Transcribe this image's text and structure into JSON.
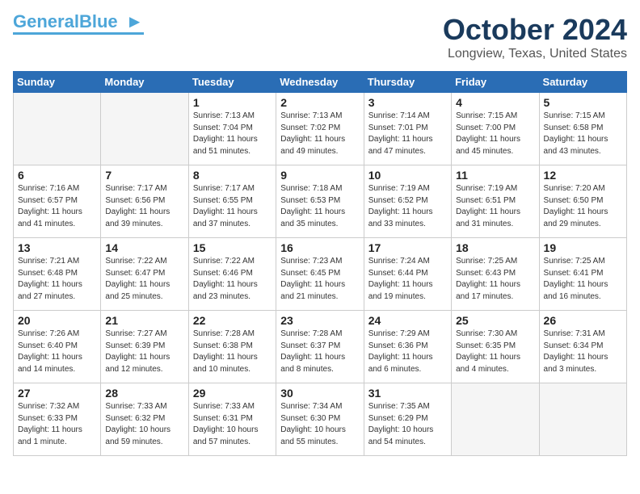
{
  "header": {
    "logo_general": "General",
    "logo_blue": "Blue",
    "month_title": "October 2024",
    "location": "Longview, Texas, United States"
  },
  "weekdays": [
    "Sunday",
    "Monday",
    "Tuesday",
    "Wednesday",
    "Thursday",
    "Friday",
    "Saturday"
  ],
  "weeks": [
    [
      {
        "day": "",
        "empty": true
      },
      {
        "day": "",
        "empty": true
      },
      {
        "day": "1",
        "sunrise": "Sunrise: 7:13 AM",
        "sunset": "Sunset: 7:04 PM",
        "daylight": "Daylight: 11 hours and 51 minutes."
      },
      {
        "day": "2",
        "sunrise": "Sunrise: 7:13 AM",
        "sunset": "Sunset: 7:02 PM",
        "daylight": "Daylight: 11 hours and 49 minutes."
      },
      {
        "day": "3",
        "sunrise": "Sunrise: 7:14 AM",
        "sunset": "Sunset: 7:01 PM",
        "daylight": "Daylight: 11 hours and 47 minutes."
      },
      {
        "day": "4",
        "sunrise": "Sunrise: 7:15 AM",
        "sunset": "Sunset: 7:00 PM",
        "daylight": "Daylight: 11 hours and 45 minutes."
      },
      {
        "day": "5",
        "sunrise": "Sunrise: 7:15 AM",
        "sunset": "Sunset: 6:58 PM",
        "daylight": "Daylight: 11 hours and 43 minutes."
      }
    ],
    [
      {
        "day": "6",
        "sunrise": "Sunrise: 7:16 AM",
        "sunset": "Sunset: 6:57 PM",
        "daylight": "Daylight: 11 hours and 41 minutes."
      },
      {
        "day": "7",
        "sunrise": "Sunrise: 7:17 AM",
        "sunset": "Sunset: 6:56 PM",
        "daylight": "Daylight: 11 hours and 39 minutes."
      },
      {
        "day": "8",
        "sunrise": "Sunrise: 7:17 AM",
        "sunset": "Sunset: 6:55 PM",
        "daylight": "Daylight: 11 hours and 37 minutes."
      },
      {
        "day": "9",
        "sunrise": "Sunrise: 7:18 AM",
        "sunset": "Sunset: 6:53 PM",
        "daylight": "Daylight: 11 hours and 35 minutes."
      },
      {
        "day": "10",
        "sunrise": "Sunrise: 7:19 AM",
        "sunset": "Sunset: 6:52 PM",
        "daylight": "Daylight: 11 hours and 33 minutes."
      },
      {
        "day": "11",
        "sunrise": "Sunrise: 7:19 AM",
        "sunset": "Sunset: 6:51 PM",
        "daylight": "Daylight: 11 hours and 31 minutes."
      },
      {
        "day": "12",
        "sunrise": "Sunrise: 7:20 AM",
        "sunset": "Sunset: 6:50 PM",
        "daylight": "Daylight: 11 hours and 29 minutes."
      }
    ],
    [
      {
        "day": "13",
        "sunrise": "Sunrise: 7:21 AM",
        "sunset": "Sunset: 6:48 PM",
        "daylight": "Daylight: 11 hours and 27 minutes."
      },
      {
        "day": "14",
        "sunrise": "Sunrise: 7:22 AM",
        "sunset": "Sunset: 6:47 PM",
        "daylight": "Daylight: 11 hours and 25 minutes."
      },
      {
        "day": "15",
        "sunrise": "Sunrise: 7:22 AM",
        "sunset": "Sunset: 6:46 PM",
        "daylight": "Daylight: 11 hours and 23 minutes."
      },
      {
        "day": "16",
        "sunrise": "Sunrise: 7:23 AM",
        "sunset": "Sunset: 6:45 PM",
        "daylight": "Daylight: 11 hours and 21 minutes."
      },
      {
        "day": "17",
        "sunrise": "Sunrise: 7:24 AM",
        "sunset": "Sunset: 6:44 PM",
        "daylight": "Daylight: 11 hours and 19 minutes."
      },
      {
        "day": "18",
        "sunrise": "Sunrise: 7:25 AM",
        "sunset": "Sunset: 6:43 PM",
        "daylight": "Daylight: 11 hours and 17 minutes."
      },
      {
        "day": "19",
        "sunrise": "Sunrise: 7:25 AM",
        "sunset": "Sunset: 6:41 PM",
        "daylight": "Daylight: 11 hours and 16 minutes."
      }
    ],
    [
      {
        "day": "20",
        "sunrise": "Sunrise: 7:26 AM",
        "sunset": "Sunset: 6:40 PM",
        "daylight": "Daylight: 11 hours and 14 minutes."
      },
      {
        "day": "21",
        "sunrise": "Sunrise: 7:27 AM",
        "sunset": "Sunset: 6:39 PM",
        "daylight": "Daylight: 11 hours and 12 minutes."
      },
      {
        "day": "22",
        "sunrise": "Sunrise: 7:28 AM",
        "sunset": "Sunset: 6:38 PM",
        "daylight": "Daylight: 11 hours and 10 minutes."
      },
      {
        "day": "23",
        "sunrise": "Sunrise: 7:28 AM",
        "sunset": "Sunset: 6:37 PM",
        "daylight": "Daylight: 11 hours and 8 minutes."
      },
      {
        "day": "24",
        "sunrise": "Sunrise: 7:29 AM",
        "sunset": "Sunset: 6:36 PM",
        "daylight": "Daylight: 11 hours and 6 minutes."
      },
      {
        "day": "25",
        "sunrise": "Sunrise: 7:30 AM",
        "sunset": "Sunset: 6:35 PM",
        "daylight": "Daylight: 11 hours and 4 minutes."
      },
      {
        "day": "26",
        "sunrise": "Sunrise: 7:31 AM",
        "sunset": "Sunset: 6:34 PM",
        "daylight": "Daylight: 11 hours and 3 minutes."
      }
    ],
    [
      {
        "day": "27",
        "sunrise": "Sunrise: 7:32 AM",
        "sunset": "Sunset: 6:33 PM",
        "daylight": "Daylight: 11 hours and 1 minute."
      },
      {
        "day": "28",
        "sunrise": "Sunrise: 7:33 AM",
        "sunset": "Sunset: 6:32 PM",
        "daylight": "Daylight: 10 hours and 59 minutes."
      },
      {
        "day": "29",
        "sunrise": "Sunrise: 7:33 AM",
        "sunset": "Sunset: 6:31 PM",
        "daylight": "Daylight: 10 hours and 57 minutes."
      },
      {
        "day": "30",
        "sunrise": "Sunrise: 7:34 AM",
        "sunset": "Sunset: 6:30 PM",
        "daylight": "Daylight: 10 hours and 55 minutes."
      },
      {
        "day": "31",
        "sunrise": "Sunrise: 7:35 AM",
        "sunset": "Sunset: 6:29 PM",
        "daylight": "Daylight: 10 hours and 54 minutes."
      },
      {
        "day": "",
        "empty": true
      },
      {
        "day": "",
        "empty": true
      }
    ]
  ]
}
